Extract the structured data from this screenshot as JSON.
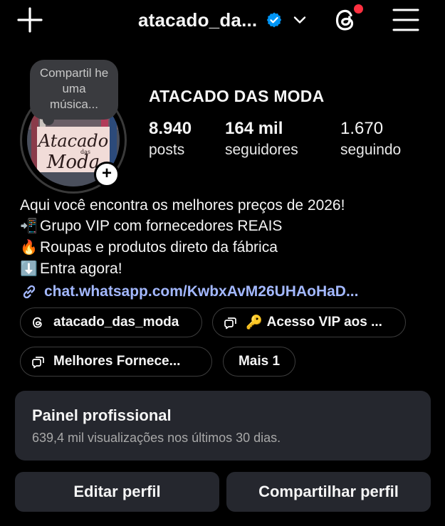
{
  "header": {
    "username": "atacado_da...",
    "create_icon": "plus-icon",
    "verified_icon": "verified-badge-icon",
    "account_switch_icon": "chevron-down-icon",
    "threads_icon": "threads-icon",
    "menu_icon": "hamburger-menu-icon",
    "verified_color": "#0095f6",
    "notification_dot_color": "#ff3040"
  },
  "profile": {
    "note_text": "Compartil he uma música...",
    "avatar_text_1": "Atacado",
    "avatar_text_2": "das",
    "avatar_text_3": "Moda",
    "add_story_symbol": "+",
    "display_name": "ATACADO DAS MODA",
    "stats": {
      "posts_value": "8.940",
      "posts_label": "posts",
      "followers_value": "164 mil",
      "followers_label": "seguidores",
      "following_value": "1.670",
      "following_label": "seguindo"
    }
  },
  "bio": {
    "line1": "Aqui você encontra os melhores preços de 2026!",
    "line2_emoji": "📲",
    "line2": "Grupo VIP com fornecedores REAIS",
    "line3_emoji": "🔥",
    "line3": "Roupas e produtos direto da fábrica",
    "line4_emoji": "⬇️",
    "line4": "Entra agora!",
    "link_icon": "link-icon",
    "link": "chat.whatsapp.com/KwbxAvM26UHAoHaD...",
    "link_color": "#a3b8ff"
  },
  "chips": {
    "threads_label": "atacado_das_moda",
    "vip_emoji": "🔑",
    "vip_label": "Acesso VIP aos ...",
    "fornece_label": "Melhores Fornece...",
    "more_label": "Mais 1"
  },
  "dashboard": {
    "title": "Painel profissional",
    "subtitle": "639,4 mil visualizações nos últimos 30 dias."
  },
  "actions": {
    "edit_label": "Editar perfil",
    "share_label": "Compartilhar perfil"
  },
  "colors": {
    "background": "#000000",
    "card": "#25272e"
  }
}
